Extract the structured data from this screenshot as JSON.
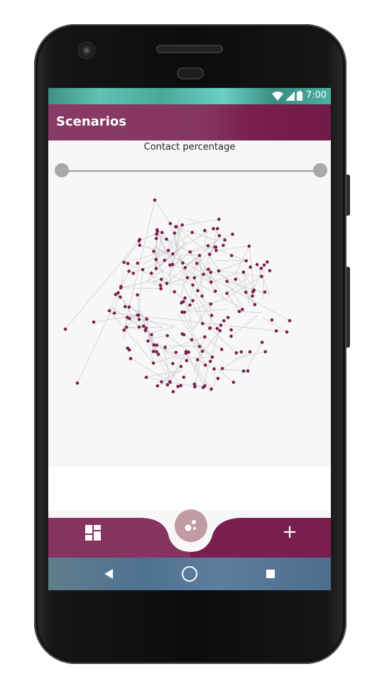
{
  "status_bar": {
    "time": "7:00",
    "icons": [
      "wifi-icon",
      "cellular-signal-icon",
      "battery-icon"
    ]
  },
  "app_bar": {
    "title": "Scenarios"
  },
  "slider": {
    "label": "Contact percentage",
    "range_min_fraction": 0.0,
    "range_max_fraction": 1.0
  },
  "network_graph": {
    "node_color": "#7a1e4f",
    "edge_color": "#c8c8c8"
  },
  "bottom_nav": {
    "left_icon": "dashboard-icon",
    "center_icon": "bubbles-icon",
    "right_label": "+"
  },
  "system_nav": {
    "icons": [
      "back-icon",
      "home-icon",
      "recent-apps-icon"
    ]
  },
  "colors": {
    "primary": "#7a1e4f",
    "primary_light": "#893a66",
    "fab": "#c29aa3",
    "status_bar": "#4fb3a5",
    "nav_bar": "#56789a"
  }
}
